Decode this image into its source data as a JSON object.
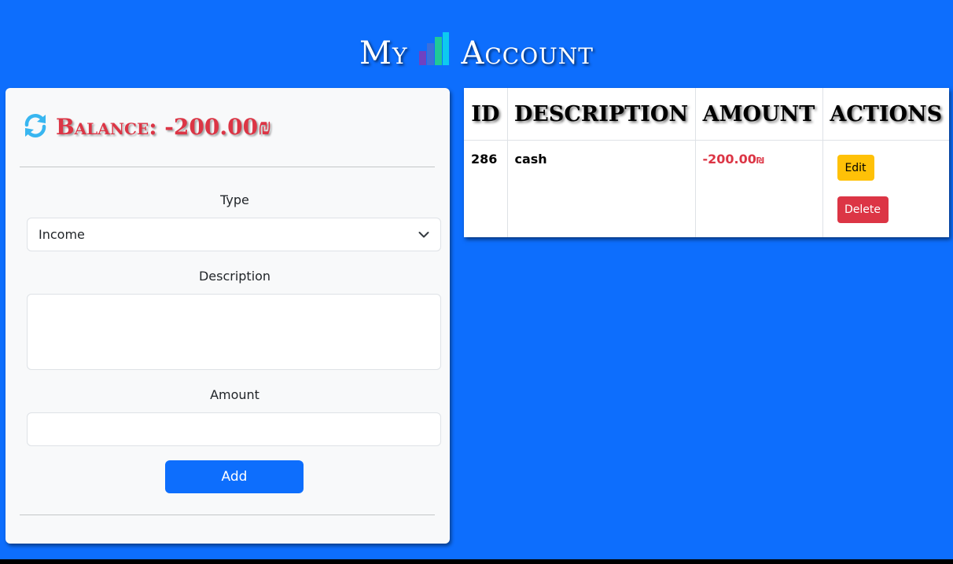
{
  "header": {
    "title_left": "My",
    "title_right": "Account",
    "logo_icon": "bar-chart-icon"
  },
  "balance": {
    "icon": "refresh-icon",
    "text": "Balance: -200.00₪",
    "color": "#dc3545"
  },
  "form": {
    "type_label": "Type",
    "type_selected": "Income",
    "description_label": "Description",
    "description_value": "",
    "amount_label": "Amount",
    "amount_value": "",
    "add_label": "Add"
  },
  "table": {
    "headers": [
      "ID",
      "DESCRIPTION",
      "AMOUNT",
      "ACTIONS"
    ],
    "rows": [
      {
        "id": "286",
        "description": "cash",
        "amount": "-200.00",
        "currency": "₪",
        "edit_label": "Edit",
        "delete_label": "Delete"
      }
    ]
  },
  "colors": {
    "background": "#0d6efd",
    "panel": "#f8f9fa",
    "danger": "#dc3545",
    "warning": "#ffc107",
    "primary": "#0d6efd"
  }
}
